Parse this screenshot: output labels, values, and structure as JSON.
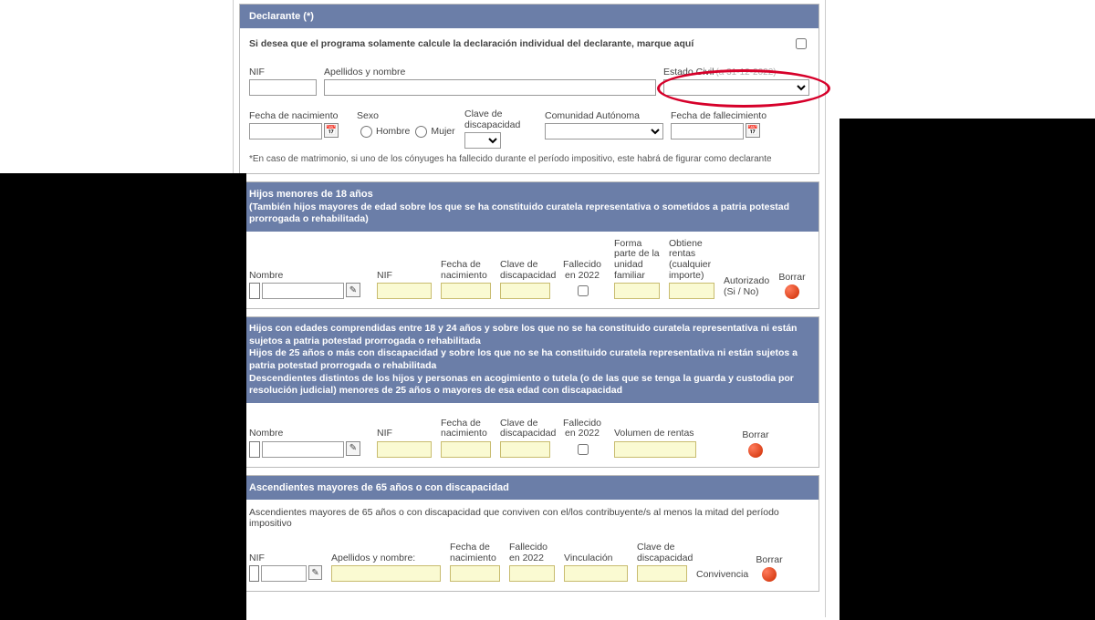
{
  "declarante": {
    "title": "Declarante (*)",
    "individual_prompt": "Si desea que el programa solamente calcule la declaración individual del declarante, marque aquí",
    "nif_label": "NIF",
    "apellidos_label": "Apellidos y nombre",
    "estado_civil_label": "Estado Civil",
    "fecha_nac_label": "Fecha de nacimiento",
    "sexo_label": "Sexo",
    "sexo_hombre": "Hombre",
    "sexo_mujer": "Mujer",
    "clave_disc_label": "Clave de discapacidad",
    "comunidad_label": "Comunidad Autónoma",
    "fecha_fall_label": "Fecha de fallecimiento",
    "footnote": "*En caso de matrimonio, si uno de los cónyuges ha fallecido durante el período impositivo, este habrá de figurar como declarante"
  },
  "hijos_menores": {
    "title_line1": "Hijos menores de 18 años",
    "title_line2": "(También hijos mayores de edad sobre los que se ha constituido curatela representativa o sometidos a patria potestad prorrogada o rehabilitada)",
    "cols": {
      "nombre": "Nombre",
      "nif": "NIF",
      "fecha_nac": "Fecha de nacimiento",
      "clave_disc": "Clave de discapacidad",
      "fallecido": "Fallecido en 2022",
      "forma_parte": "Forma parte de la unidad familiar",
      "obtiene_rentas": "Obtiene rentas (cualquier importe)",
      "autorizado": "Autorizado (Si / No)",
      "borrar": "Borrar"
    }
  },
  "hijos_1824": {
    "title_line1": "Hijos con edades comprendidas entre 18 y 24 años y sobre los que no se ha constituido curatela representativa ni están sujetos a patria potestad prorrogada o rehabilitada",
    "title_line2": "Hijos de 25 años o más con discapacidad y sobre los que no se ha constituido curatela representativa ni están sujetos a patria potestad prorrogada o rehabilitada",
    "title_line3": "Descendientes distintos de los hijos y personas en acogimiento o tutela (o de las que se tenga la guarda y custodia por resolución judicial) menores de 25 años o mayores de esa edad con discapacidad",
    "cols": {
      "nombre": "Nombre",
      "nif": "NIF",
      "fecha_nac": "Fecha de nacimiento",
      "clave_disc": "Clave de discapacidad",
      "fallecido": "Fallecido en 2022",
      "volumen": "Volumen de rentas",
      "borrar": "Borrar"
    }
  },
  "ascendientes": {
    "title": "Ascendientes mayores de 65 años o con discapacidad",
    "subtitle": "Ascendientes mayores de 65 años o con discapacidad que conviven con el/los contribuyente/s al menos la mitad del período impositivo",
    "cols": {
      "nif": "NIF",
      "apellidos": "Apellidos y nombre:",
      "fecha_nac": "Fecha de nacimiento",
      "fallecido": "Fallecido en 2022",
      "vinculacion": "Vinculación",
      "clave_disc": "Clave de discapacidad",
      "convivencia": "Convivencia",
      "borrar": "Borrar"
    }
  }
}
